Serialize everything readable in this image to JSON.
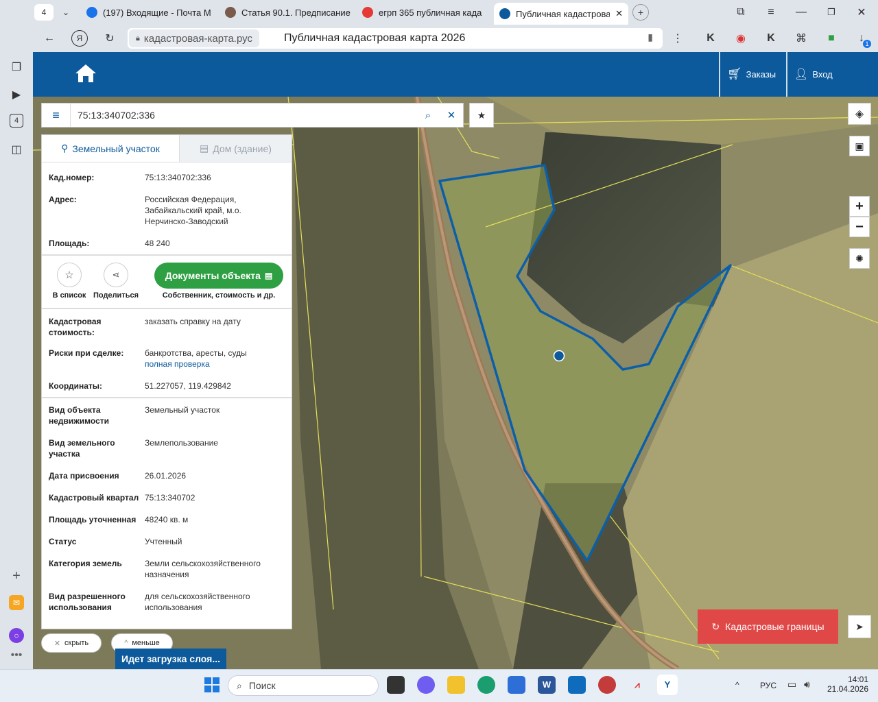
{
  "browser": {
    "tab_count": "4",
    "tabs": [
      {
        "label": "(197) Входящие - Почта М",
        "icon": "mail-icon",
        "color": "#1a73e8"
      },
      {
        "label": "Статья 90.1. Предписание",
        "icon": "article-icon",
        "color": "#7a5a4a"
      },
      {
        "label": "егрп 365 публичная када",
        "icon": "yandex-icon",
        "color": "#e53935"
      },
      {
        "label": "Публичная кадастрова",
        "icon": "home-icon",
        "color": "#0c5a9c"
      }
    ],
    "url": "кадастровая-карта.рус",
    "page_title": "Публичная кадастровая карта 2026",
    "download_badge": "1"
  },
  "header": {
    "orders_label": "Заказы",
    "login_label": "Вход"
  },
  "search": {
    "value": "75:13:340702:336"
  },
  "panel": {
    "tab_land": "Земельный участок",
    "tab_building": "Дом (здание)",
    "fields_top": [
      {
        "key": "Кад.номер:",
        "value": "75:13:340702:336",
        "link": true
      },
      {
        "key": "Адрес:",
        "value": "Российская Федерация, Забайкальский край, м.о. Нерчинско-Заводский",
        "link": false
      },
      {
        "key": "Площадь:",
        "value": "48 240",
        "link": false
      }
    ],
    "action_add": "В список",
    "action_share": "Поделиться",
    "docs_button": "Документы объекта",
    "docs_sub": "Собственник, стоимость и др.",
    "cost_key": "Кадастровая стоимость:",
    "cost_link": "заказать справку на дату",
    "risks_key": "Риски при сделке:",
    "risks_value": "банкротства, аресты, суды",
    "risks_link": "полная проверка",
    "coords_key": "Координаты:",
    "coords_value": "51.227057, 119.429842",
    "fields_bottom": [
      {
        "key": "Вид объекта недвижимости",
        "value": "Земельный участок"
      },
      {
        "key": "Вид земельного участка",
        "value": "Землепользование"
      },
      {
        "key": "Дата присвоения",
        "value": "26.01.2026"
      },
      {
        "key": "Кадастровый квартал",
        "value": "75:13:340702"
      },
      {
        "key": "Площадь уточненная",
        "value": "48240 кв. м"
      },
      {
        "key": "Статус",
        "value": "Учтенный"
      },
      {
        "key": "Категория земель",
        "value": "Земли сельскохозяйственного назначения"
      },
      {
        "key": "Вид разрешенного использования",
        "value": "для сельскохозяйственного использования"
      }
    ],
    "hide_label": "скрыть",
    "less_label": "меньше"
  },
  "map": {
    "loading_label": "Идет загрузка слоя...",
    "cadastral_button": "Кадастровые границы",
    "zoom_in": "+",
    "zoom_out": "−"
  },
  "taskbar": {
    "search_placeholder": "Поиск",
    "lang": "РУС",
    "time": "14:01",
    "date": "21.04.2026"
  },
  "colors": {
    "brand": "#0c5a9c",
    "green_button": "#2ea043",
    "red_button": "#e04848",
    "parcel_outline": "#0b5fa8"
  }
}
